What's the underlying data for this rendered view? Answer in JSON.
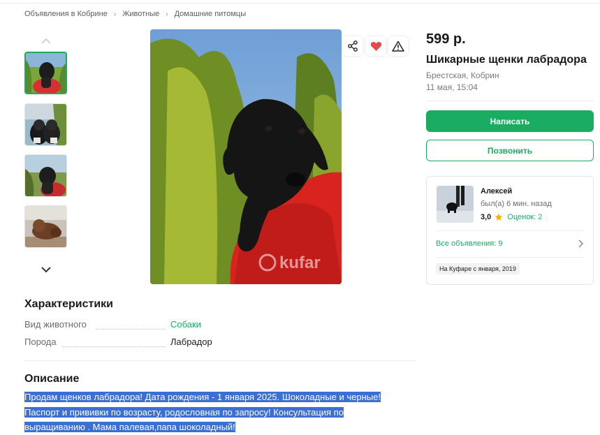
{
  "breadcrumbs": [
    "Объявления в Кобрине",
    "Животные",
    "Домашние питомцы"
  ],
  "gallery": {
    "thumb_count": 4,
    "selected_thumb": 1,
    "watermark": "kufar"
  },
  "actions": {
    "share_icon": "share-icon",
    "favorite_icon": "heart-icon",
    "report_icon": "warning-icon"
  },
  "listing": {
    "price": "599 р.",
    "title": "Шикарные щенки лабрадора",
    "location": "Брестская, Кобрин",
    "date": "11 мая, 15:04"
  },
  "buttons": {
    "write": "Написать",
    "call": "Позвонить"
  },
  "seller": {
    "name": "Алексей",
    "last_seen": "был(а) 6 мин. назад",
    "rating": "3,0",
    "reviews": "Оценок: 2",
    "all_ads": "Все объявления: 9",
    "since": "На Куфаре с января, 2019"
  },
  "characteristics": {
    "heading": "Характеристики",
    "rows": [
      {
        "label": "Вид животного",
        "value": "Собаки"
      },
      {
        "label": "Порода",
        "value": "Лабрадор"
      }
    ]
  },
  "description": {
    "heading": "Описание",
    "lines": [
      "Продам щенков лабрадора! Дата рождения - 1 января 2025. Шоколадные и черные!",
      "Паспорт и прививки по возрасту, родословная по запросу! Консультация по",
      "выращиванию . Мама палевая,папа шоколадный!"
    ]
  },
  "colors": {
    "accent": "#1aad62",
    "selection": "#3b6fd4",
    "heart": "#e5484d",
    "star": "#f5b400"
  }
}
